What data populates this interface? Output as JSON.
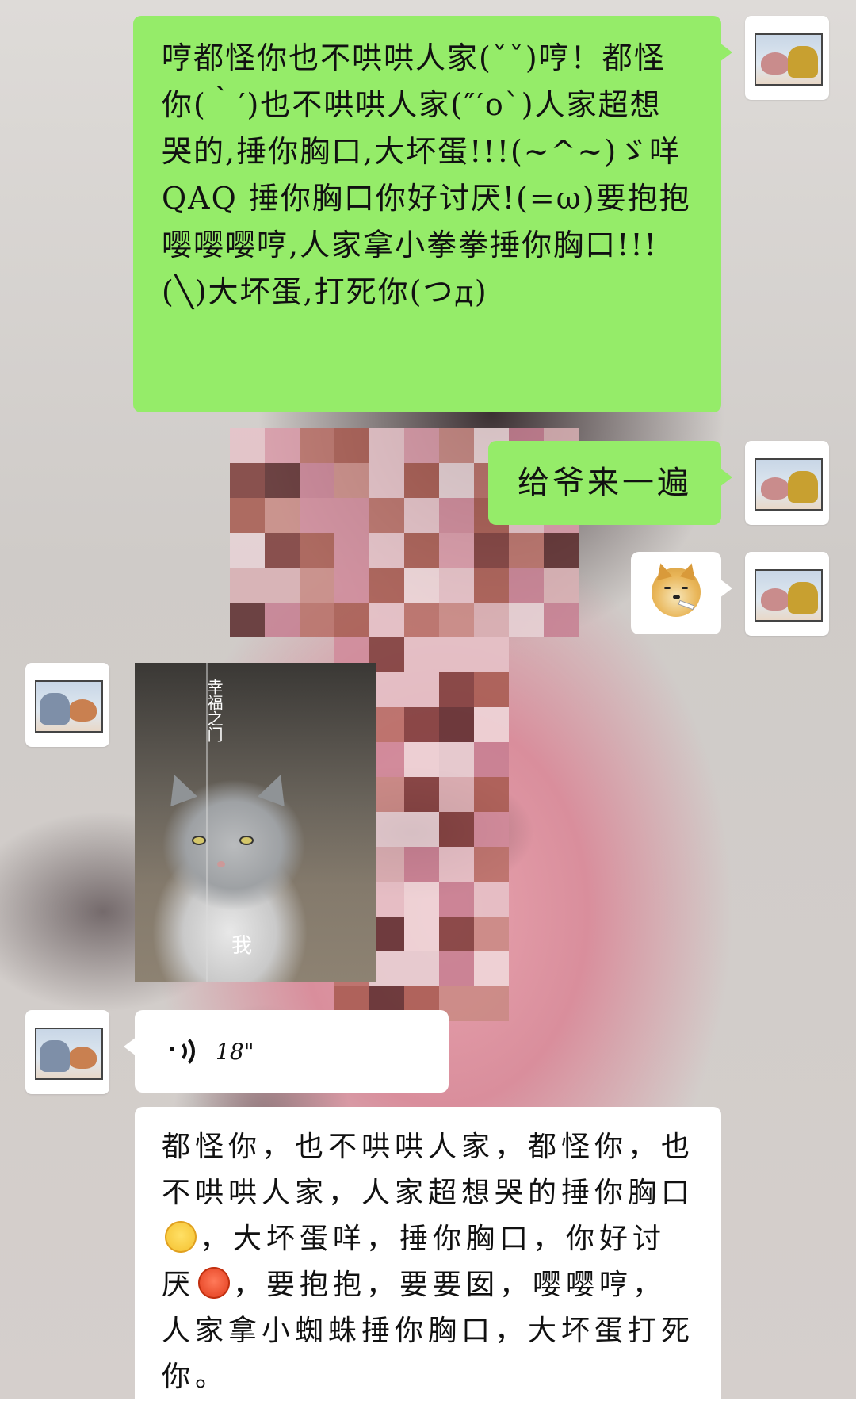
{
  "messages": [
    {
      "sender": "self",
      "type": "text",
      "text": "哼都怪你也不哄哄人家(ˇˇ)哼！都怪你(｀′)也不哄哄人家(″′o`)人家超想哭的,捶你胸口,大坏蛋!!!(~^~)ゞ咩QAQ 捶你胸口你好讨厌!(=ω)要抱抱嘤嘤嘤哼,人家拿小拳拳捶你胸口!!!(╲)大坏蛋,打死你(つд)"
    },
    {
      "sender": "self",
      "type": "text",
      "text": "给爷来一遍"
    },
    {
      "sender": "self",
      "type": "sticker",
      "sticker": "doge-smoking"
    },
    {
      "sender": "other",
      "type": "image",
      "overlay_vertical": "幸福之门",
      "overlay_label": "我"
    },
    {
      "sender": "other",
      "type": "voice",
      "duration": "18\""
    },
    {
      "sender": "other",
      "type": "text",
      "parts": [
        "都怪你，也不哄哄人家，都怪你，也不哄哄人家，人家超想哭的捶你胸口",
        "，大坏蛋咩，捶你胸口，你好讨厌",
        "，要抱抱，要要囡，嘤嘤哼，人家拿小蜘蛛捶你胸口，大坏蛋打死你。"
      ],
      "emojis": [
        "loudly-crying-face",
        "angry-face"
      ]
    }
  ],
  "colors": {
    "self_bubble": "#95ec69",
    "other_bubble": "#ffffff"
  }
}
